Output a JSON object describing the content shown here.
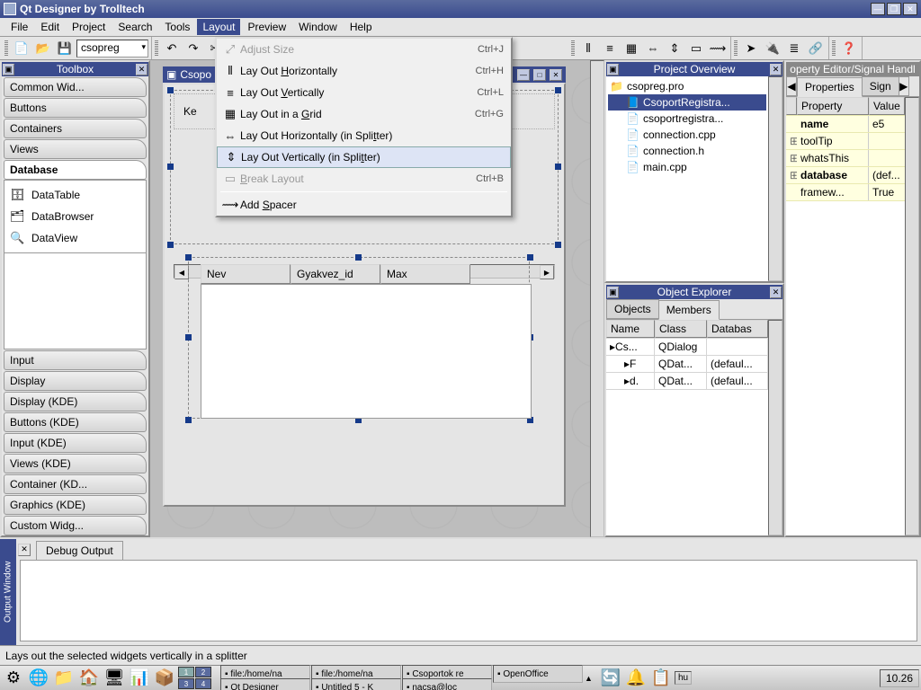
{
  "window": {
    "title": "Qt Designer by Trolltech"
  },
  "menubar": [
    "File",
    "Edit",
    "Project",
    "Search",
    "Tools",
    "Layout",
    "Preview",
    "Window",
    "Help"
  ],
  "menubar_open_index": 5,
  "toolbar": {
    "combo": "csopreg"
  },
  "dropdown": {
    "items": [
      {
        "icon": "⤢",
        "label": "Adjust Size",
        "shortcut": "Ctrl+J",
        "disabled": true
      },
      {
        "icon": "⦀",
        "label": "Lay Out Horizontally",
        "shortcut": "Ctrl+H",
        "u": 8
      },
      {
        "icon": "≡",
        "label": "Lay Out Vertically",
        "shortcut": "Ctrl+L",
        "u": 8
      },
      {
        "icon": "▦",
        "label": "Lay Out in a Grid",
        "shortcut": "Ctrl+G",
        "u": 13
      },
      {
        "icon": "⇔",
        "label": "Lay Out Horizontally (in Splitter)",
        "u": 29
      },
      {
        "icon": "⇕",
        "label": "Lay Out Vertically (in Splitter)",
        "u": 27,
        "hover": true
      },
      {
        "icon": "▭",
        "label": "Break Layout",
        "shortcut": "Ctrl+B",
        "disabled": true,
        "u": 0
      },
      {
        "sep": true
      },
      {
        "icon": "⟿",
        "label": "Add Spacer",
        "u": 4
      }
    ]
  },
  "toolbox": {
    "title": "Toolbox",
    "tabs_before": [
      "Common Wid...",
      "Buttons",
      "Containers",
      "Views"
    ],
    "active_tab": "Database",
    "widgets": [
      {
        "icon": "🗄",
        "label": "DataTable"
      },
      {
        "icon": "🗂",
        "label": "DataBrowser"
      },
      {
        "icon": "🔍",
        "label": "DataView"
      }
    ],
    "tabs_after": [
      "Input",
      "Display",
      "Display (KDE)",
      "Buttons (KDE)",
      "Input (KDE)",
      "Views (KDE)",
      "Container (KD...",
      "Graphics (KDE)",
      "Custom Widg..."
    ]
  },
  "designer": {
    "win_title": "Csopo",
    "top_label": "Ke",
    "table_cols": [
      "Nev",
      "Gyakvez_id",
      "Max"
    ]
  },
  "project": {
    "title": "Project Overview",
    "root": "csopreg.pro",
    "items": [
      {
        "label": "CsoportRegistra...",
        "sel": true,
        "icon": "📘"
      },
      {
        "label": "csoportregistra...",
        "icon": "📄"
      },
      {
        "label": "connection.cpp",
        "icon": "📄"
      },
      {
        "label": "connection.h",
        "icon": "📄"
      },
      {
        "label": "main.cpp",
        "icon": "📄"
      }
    ]
  },
  "object_explorer": {
    "title": "Object Explorer",
    "tabs": [
      "Objects",
      "Members"
    ],
    "active_tab": 1,
    "cols": [
      "Name",
      "Class",
      "Databas"
    ],
    "rows": [
      {
        "name": "Cs...",
        "class": "QDialog",
        "db": ""
      },
      {
        "name": "F",
        "class": "QDat...",
        "db": "(defaul...",
        "indent": 1
      },
      {
        "name": "d.",
        "class": "QDat...",
        "db": "(defaul...",
        "indent": 1
      }
    ]
  },
  "property_editor": {
    "title": "operty Editor/Signal Handl",
    "tabs": [
      "Properties",
      "Sign"
    ],
    "cols": [
      "Property",
      "Value"
    ],
    "rows": [
      {
        "k": "name",
        "v": "e5",
        "bold": true,
        "exp": ""
      },
      {
        "k": "toolTip",
        "v": "",
        "exp": "⊞"
      },
      {
        "k": "whatsThis",
        "v": "",
        "exp": "⊞"
      },
      {
        "k": "database",
        "v": "(def...",
        "bold": true,
        "exp": "⊞"
      },
      {
        "k": "framew...",
        "v": "True",
        "exp": ""
      }
    ]
  },
  "output": {
    "side": "Output Window",
    "tab": "Debug Output"
  },
  "statusbar": "Lays out the selected widgets vertically in a splitter",
  "taskbar": {
    "desktops": [
      "1",
      "2",
      "3",
      "4"
    ],
    "tasks": [
      "file:/home/na",
      "file:/home/na",
      "Csoportok re",
      "OpenOffice",
      "Qt Designer",
      "Untitled 5 - K",
      "nacsa@loc"
    ],
    "lang": "hu",
    "clock": "10.26"
  }
}
